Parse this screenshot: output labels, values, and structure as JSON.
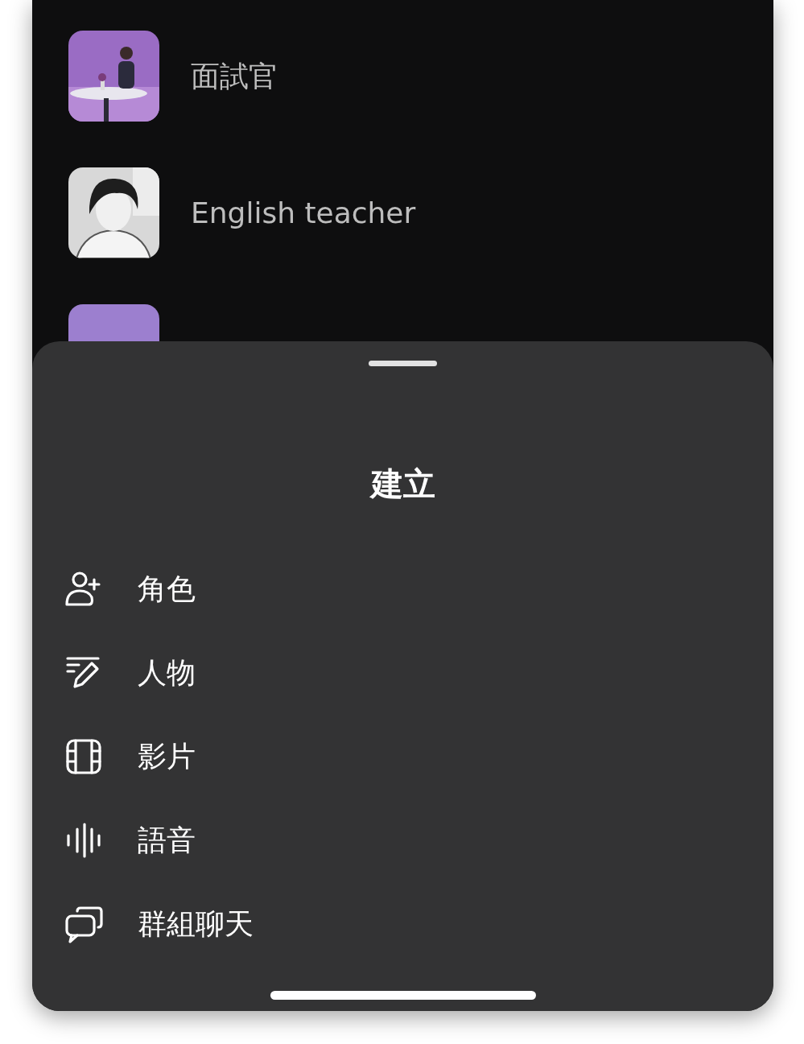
{
  "characters": [
    {
      "name": "面試官"
    },
    {
      "name": "English teacher"
    },
    {
      "avatar": {
        "kind": "plain"
      }
    }
  ],
  "sheet": {
    "title": "建立",
    "items": [
      {
        "kind": "person-add",
        "label": "角色"
      },
      {
        "kind": "persona",
        "label": "人物"
      },
      {
        "kind": "video",
        "label": "影片"
      },
      {
        "kind": "voice",
        "label": "語音"
      },
      {
        "kind": "group-chat",
        "label": "群組聊天"
      }
    ]
  }
}
